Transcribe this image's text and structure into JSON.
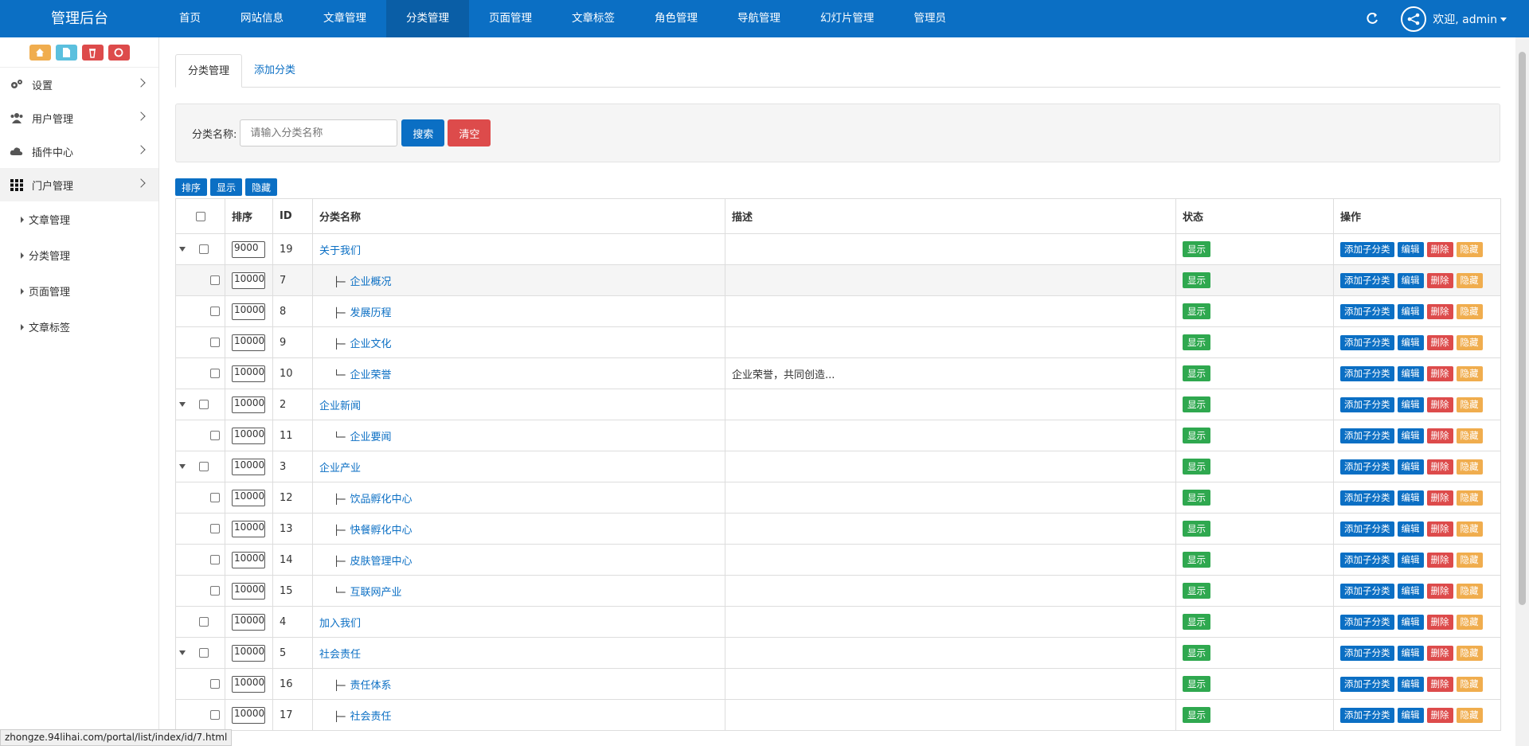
{
  "brand": "管理后台",
  "nav": [
    {
      "label": "首页",
      "active": false
    },
    {
      "label": "网站信息",
      "active": false
    },
    {
      "label": "文章管理",
      "active": false
    },
    {
      "label": "分类管理",
      "active": true
    },
    {
      "label": "页面管理",
      "active": false
    },
    {
      "label": "文章标签",
      "active": false
    },
    {
      "label": "角色管理",
      "active": false
    },
    {
      "label": "导航管理",
      "active": false
    },
    {
      "label": "幻灯片管理",
      "active": false
    },
    {
      "label": "管理员",
      "active": false
    }
  ],
  "user": {
    "welcome": "欢迎, admin"
  },
  "quick_buttons": [
    {
      "icon": "home-icon",
      "color": "#f0ad4e"
    },
    {
      "icon": "file-icon",
      "color": "#5bc0de"
    },
    {
      "icon": "trash-icon",
      "color": "#dd4b4b"
    },
    {
      "icon": "recycle-icon",
      "color": "#dd4b4b"
    }
  ],
  "sidebar": {
    "items": [
      {
        "label": "设置",
        "icon": "gears-icon"
      },
      {
        "label": "用户管理",
        "icon": "users-icon"
      },
      {
        "label": "插件中心",
        "icon": "cloud-icon"
      },
      {
        "label": "门户管理",
        "icon": "grid-icon"
      }
    ],
    "sub_items": [
      {
        "label": "文章管理"
      },
      {
        "label": "分类管理"
      },
      {
        "label": "页面管理"
      },
      {
        "label": "文章标签"
      }
    ]
  },
  "status_url": "zhongze.94lihai.com/portal/list/index/id/7.html",
  "tabs": [
    {
      "label": "分类管理",
      "active": true
    },
    {
      "label": "添加分类",
      "active": false
    }
  ],
  "search": {
    "label": "分类名称:",
    "placeholder": "请输入分类名称",
    "search_btn": "搜索",
    "clear_btn": "清空"
  },
  "toolbar": [
    "排序",
    "显示",
    "隐藏"
  ],
  "table": {
    "headers": [
      "排序",
      "ID",
      "分类名称",
      "描述",
      "状态",
      "操作"
    ],
    "status_label": "显示",
    "ops": {
      "add": "添加子分类",
      "edit": "编辑",
      "del": "删除",
      "hide": "隐藏"
    },
    "rows": [
      {
        "level": 0,
        "expandable": true,
        "sort": "9000",
        "id": "19",
        "prefix": "",
        "name": "关于我们",
        "desc": ""
      },
      {
        "level": 1,
        "expandable": false,
        "sort": "10000",
        "id": "7",
        "prefix": "├─",
        "name": "企业概况",
        "desc": "",
        "highlight": true
      },
      {
        "level": 1,
        "expandable": false,
        "sort": "10000",
        "id": "8",
        "prefix": "├─",
        "name": "发展历程",
        "desc": ""
      },
      {
        "level": 1,
        "expandable": false,
        "sort": "10000",
        "id": "9",
        "prefix": "├─",
        "name": "企业文化",
        "desc": ""
      },
      {
        "level": 1,
        "expandable": false,
        "sort": "10000",
        "id": "10",
        "prefix": "└─",
        "name": "企业荣誉",
        "desc": "企业荣誉，共同创造..."
      },
      {
        "level": 0,
        "expandable": true,
        "sort": "10000",
        "id": "2",
        "prefix": "",
        "name": "企业新闻",
        "desc": ""
      },
      {
        "level": 1,
        "expandable": false,
        "sort": "10000",
        "id": "11",
        "prefix": "└─",
        "name": "企业要闻",
        "desc": ""
      },
      {
        "level": 0,
        "expandable": true,
        "sort": "10000",
        "id": "3",
        "prefix": "",
        "name": "企业产业",
        "desc": ""
      },
      {
        "level": 1,
        "expandable": false,
        "sort": "10000",
        "id": "12",
        "prefix": "├─",
        "name": "饮品孵化中心",
        "desc": ""
      },
      {
        "level": 1,
        "expandable": false,
        "sort": "10000",
        "id": "13",
        "prefix": "├─",
        "name": "快餐孵化中心",
        "desc": ""
      },
      {
        "level": 1,
        "expandable": false,
        "sort": "10000",
        "id": "14",
        "prefix": "├─",
        "name": "皮肤管理中心",
        "desc": ""
      },
      {
        "level": 1,
        "expandable": false,
        "sort": "10000",
        "id": "15",
        "prefix": "└─",
        "name": "互联网产业",
        "desc": ""
      },
      {
        "level": 0,
        "expandable": false,
        "sort": "10000",
        "id": "4",
        "prefix": "",
        "name": "加入我们",
        "desc": ""
      },
      {
        "level": 0,
        "expandable": true,
        "sort": "10000",
        "id": "5",
        "prefix": "",
        "name": "社会责任",
        "desc": ""
      },
      {
        "level": 1,
        "expandable": false,
        "sort": "10000",
        "id": "16",
        "prefix": "├─",
        "name": "责任体系",
        "desc": ""
      },
      {
        "level": 1,
        "expandable": false,
        "sort": "10000",
        "id": "17",
        "prefix": "├─",
        "name": "社会责任",
        "desc": ""
      }
    ]
  }
}
